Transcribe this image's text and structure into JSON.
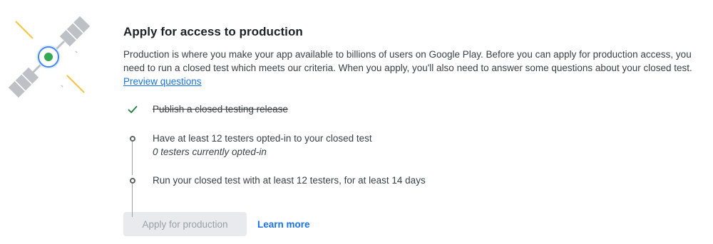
{
  "header": {
    "title": "Apply for access to production",
    "description": "Production is where you make your app available to billions of users on Google Play. Before you can apply for production access, you need to run a closed test which meets our criteria. When you apply, you'll also need to answer some questions about your closed test.",
    "preview_link": "Preview questions"
  },
  "steps": [
    {
      "label": "Publish a closed testing release",
      "status": "done",
      "icon": "check-icon"
    },
    {
      "label": "Have at least 12 testers opted-in to your closed test",
      "sublabel": "0 testers currently opted-in",
      "status": "pending",
      "icon": "circle-outline-icon"
    },
    {
      "label": "Run your closed test with at least 12 testers, for at least 14 days",
      "status": "pending",
      "icon": "circle-outline-icon"
    }
  ],
  "actions": {
    "apply_label": "Apply for production",
    "apply_enabled": false,
    "learn_more_label": "Learn more"
  },
  "colors": {
    "accent": "#1a73e8",
    "check": "#188038",
    "disabled_bg": "#e8eaed",
    "disabled_text": "#9aa0a6"
  },
  "illustration": {
    "icon": "satellite-icon"
  }
}
